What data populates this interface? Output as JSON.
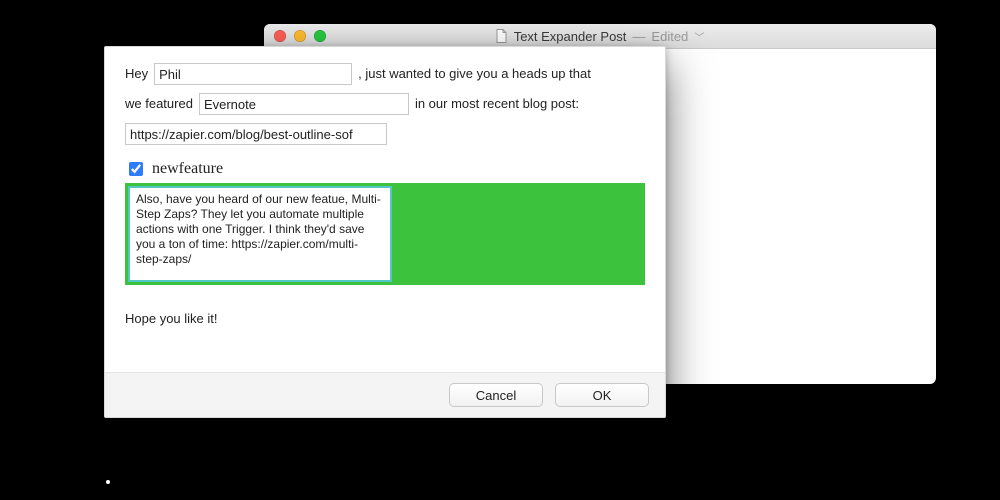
{
  "editor_window": {
    "title": "Text Expander Post",
    "status": "Edited"
  },
  "dialog": {
    "line1": {
      "prefix": "Hey",
      "name_value": "Phil",
      "suffix": ", just wanted to give you a heads up that"
    },
    "line2": {
      "prefix": "we featured",
      "company_value": "Evernote",
      "suffix": "in our most recent blog post:"
    },
    "url_value": "https://zapier.com/blog/best-outline-sof",
    "feature": {
      "checked": true,
      "name": "newfeature",
      "body": "Also, have you heard of our new featue, Multi-Step Zaps? They let you automate multiple actions with one Trigger. I think they'd save you a ton of time: https://zapier.com/multi-step-zaps/"
    },
    "closing": "Hope you like it!",
    "buttons": {
      "cancel": "Cancel",
      "ok": "OK"
    }
  }
}
